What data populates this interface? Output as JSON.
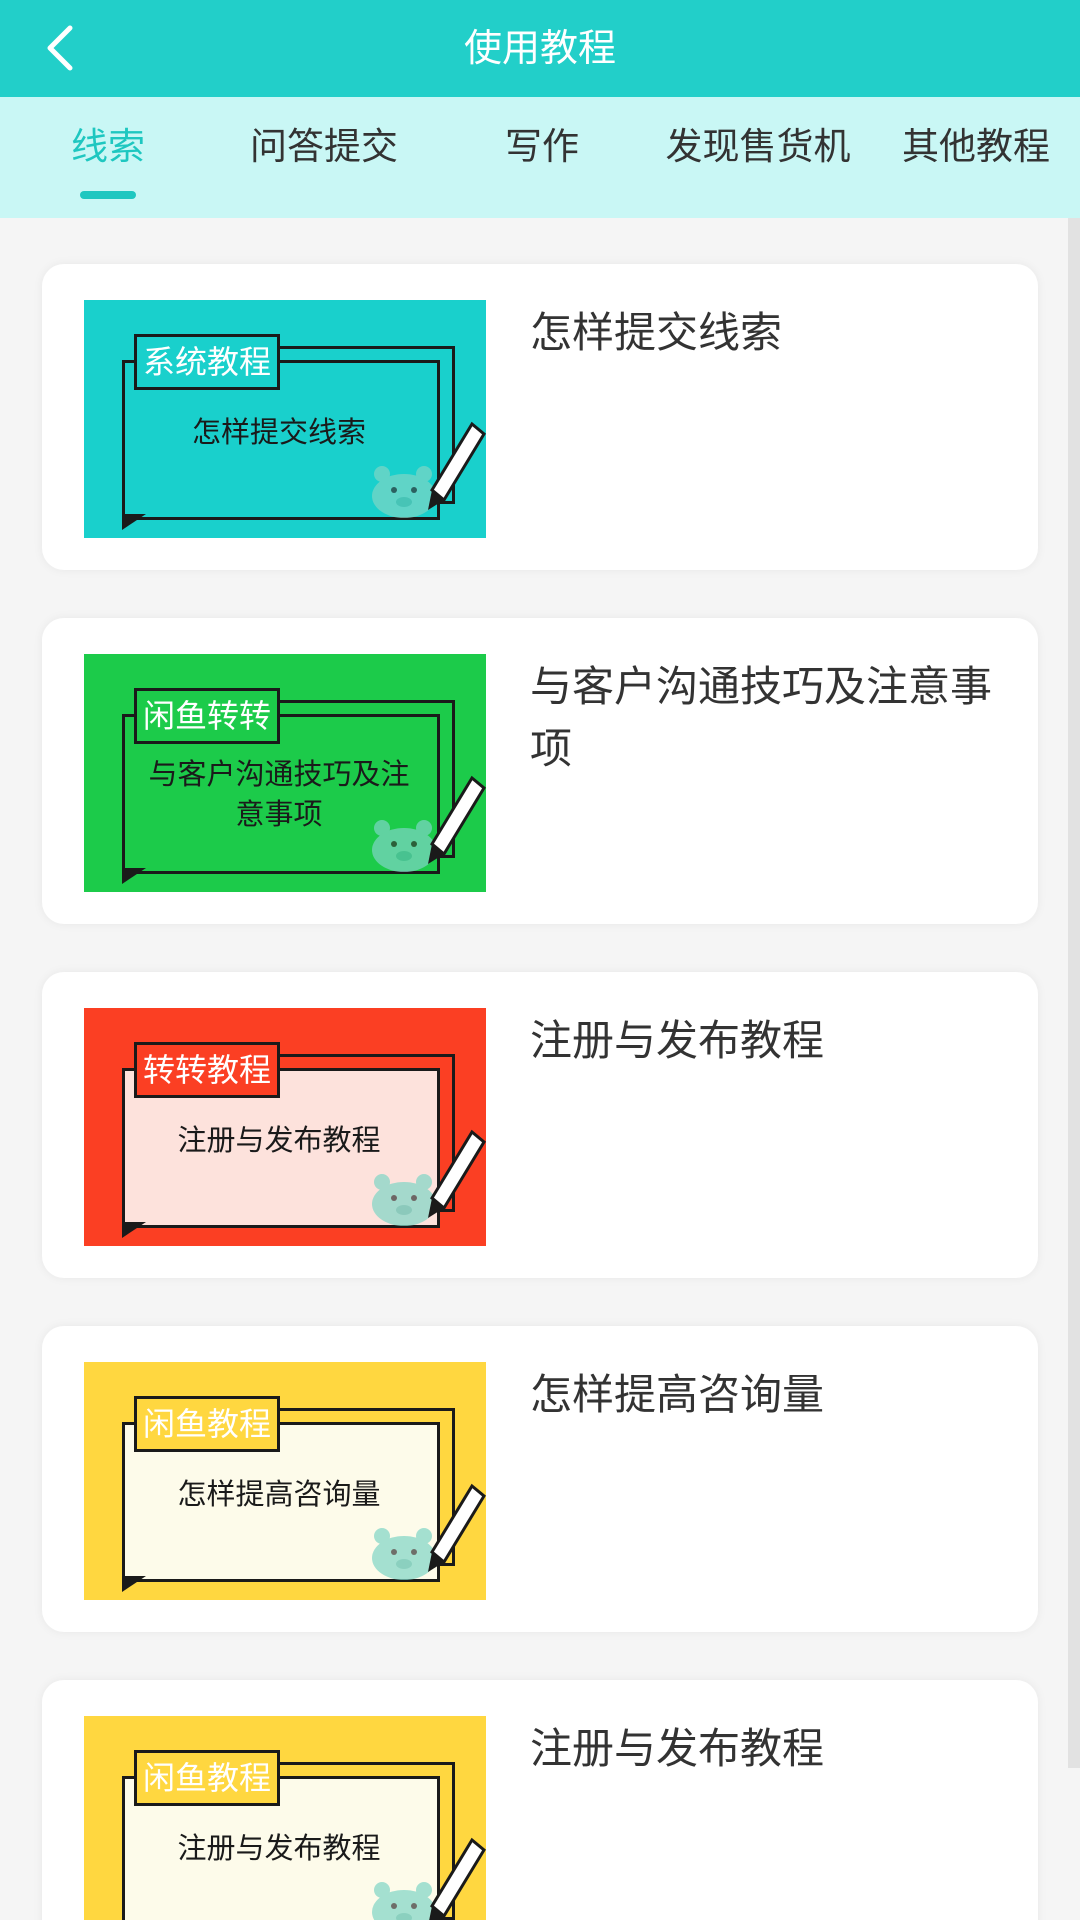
{
  "header": {
    "title": "使用教程",
    "back_icon": "chevron-left-icon",
    "bg_color": "#22cfc9"
  },
  "tabs": [
    {
      "label": "线索",
      "active": true
    },
    {
      "label": "问答提交",
      "active": false
    },
    {
      "label": "写作",
      "active": false
    },
    {
      "label": "发现售货机",
      "active": false
    },
    {
      "label": "其他教程",
      "active": false
    }
  ],
  "accent_color": "#1ec7c0",
  "cards": [
    {
      "title": "怎样提交线索",
      "thumb_tag": "系统教程",
      "thumb_text": "怎样提交线索",
      "thumb_bg": "#19d0cc",
      "thumb_inner": "#19d0cc",
      "tag_bg": "#19d0cc",
      "tag_color": "#ffffff"
    },
    {
      "title": "与客户沟通技巧及注意事项",
      "thumb_tag": "闲鱼转转",
      "thumb_text": "与客户沟通技巧及注意事项",
      "thumb_bg": "#1ccb4a",
      "thumb_inner": "#1ccb4a",
      "tag_bg": "#1ccb4a",
      "tag_color": "#ffffff"
    },
    {
      "title": "注册与发布教程",
      "thumb_tag": "转转教程",
      "thumb_text": "注册与发布教程",
      "thumb_bg": "#fb3f23",
      "thumb_inner": "#fde2dc",
      "tag_bg": "#fb3f23",
      "tag_color": "#ffffff"
    },
    {
      "title": "怎样提高咨询量",
      "thumb_tag": "闲鱼教程",
      "thumb_text": "怎样提高咨询量",
      "thumb_bg": "#ffd740",
      "thumb_inner": "#fdfbea",
      "tag_bg": "#ffd740",
      "tag_color": "#ffffff"
    },
    {
      "title": "注册与发布教程",
      "thumb_tag": "闲鱼教程",
      "thumb_text": "注册与发布教程",
      "thumb_bg": "#ffd740",
      "thumb_inner": "#fdfbea",
      "tag_bg": "#ffd740",
      "tag_color": "#ffffff"
    }
  ]
}
